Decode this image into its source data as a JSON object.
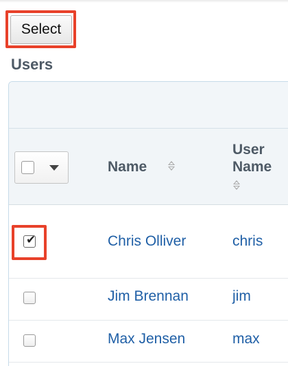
{
  "toolbar": {
    "select_label": "Select"
  },
  "section": {
    "title": "Users"
  },
  "table": {
    "columns": {
      "name": "Name",
      "username_line1": "User",
      "username_line2": "Name"
    },
    "rows": [
      {
        "name": "Chris Olliver",
        "username": "chris",
        "checked": true
      },
      {
        "name": "Jim Brennan",
        "username": "jim",
        "checked": false
      },
      {
        "name": "Max Jensen",
        "username": "max",
        "checked": false
      }
    ]
  },
  "icons": {
    "check": "✔",
    "sort": "sort-icon",
    "caret": "chevron-down-icon"
  },
  "colors": {
    "highlight": "#e8412a",
    "link": "#1f5fa6",
    "header_text": "#4e5a66"
  }
}
